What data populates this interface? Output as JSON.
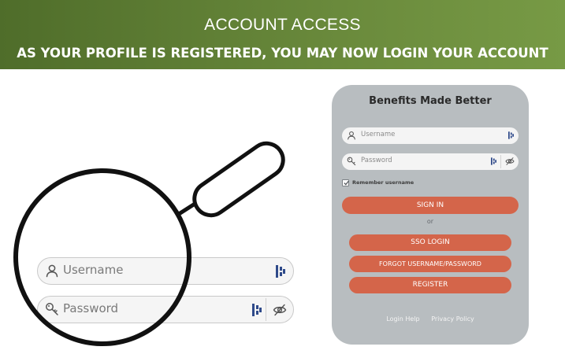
{
  "banner": {
    "title": "ACCOUNT ACCESS",
    "subtitle": "AS YOUR PROFILE IS REGISTERED, YOU MAY NOW LOGIN YOUR ACCOUNT",
    "color_start": "#4f6d2a",
    "color_end": "#779a45"
  },
  "zoom": {
    "username_placeholder": "Username",
    "password_placeholder": "Password",
    "icons": [
      "user-icon",
      "key-icon",
      "password-manager-icon",
      "eye-slash-icon",
      "magnifying-glass-icon"
    ]
  },
  "card": {
    "title": "Benefits Made Better",
    "username_placeholder": "Username",
    "password_placeholder": "Password",
    "remember_label": "Remember username",
    "remember_checked": true,
    "signin_label": "SIGN IN",
    "or_label": "or",
    "sso_label": "SSO LOGIN",
    "forgot_label": "FORGOT USERNAME/PASSWORD",
    "register_label": "REGISTER",
    "login_help": "Login Help",
    "privacy_policy": "Privacy Policy",
    "background": "#b8bdc0",
    "button_color": "#d4654a"
  }
}
